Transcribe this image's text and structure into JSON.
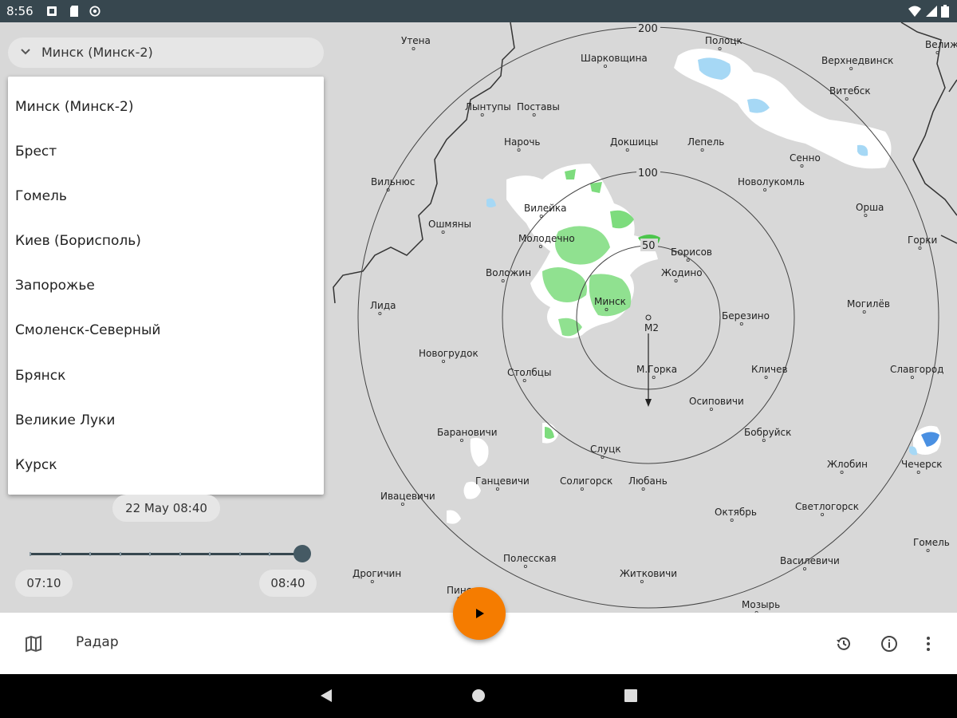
{
  "status_bar": {
    "time": "8:56",
    "icons": [
      "notification-icon",
      "sd-card-icon",
      "sync-icon",
      "wifi-icon",
      "signal-icon",
      "battery-icon"
    ]
  },
  "station_selector": {
    "selected": "Минск (Минск-2)",
    "icon": "chevron-down-icon"
  },
  "station_list": [
    "Минск (Минск-2)",
    "Брест",
    "Гомель",
    "Киев (Борисполь)",
    "Запорожье",
    "Смоленск-Северный",
    "Брянск",
    "Великие Луки",
    "Курск"
  ],
  "timeline": {
    "current": "22 May 08:40",
    "start": "07:10",
    "end": "08:40",
    "position": 1.0
  },
  "map": {
    "ring_labels": [
      "200",
      "100",
      "50"
    ],
    "station_marker": "M2",
    "cities": [
      "Утена",
      "Полоцк",
      "Велиж",
      "Шарковщина",
      "Верхнедвинск",
      "Лынтупы",
      "Поставы",
      "Витебск",
      "Нарочь",
      "Докшицы",
      "Лепель",
      "Сенно",
      "Вильнюс",
      "Новолукомль",
      "Вилейка",
      "Орша",
      "Ошмяны",
      "Молодечно",
      "Борисов",
      "Горки",
      "Воложин",
      "Жодино",
      "Лида",
      "Минск",
      "Березино",
      "Могилёв",
      "Новогрудок",
      "Столбцы",
      "М.Горка",
      "Кличев",
      "Славгород",
      "Осиповичи",
      "Барановичи",
      "Бобруйск",
      "Слуцк",
      "Чечерск",
      "Жлобин",
      "Ганцевичи",
      "Солигорск",
      "Любань",
      "Ивацевичи",
      "Октябрь",
      "Светлогорск",
      "Гомель",
      "Полесская",
      "Василевичи",
      "Дрогичин",
      "Житковичи",
      "Пинск",
      "Мозырь"
    ],
    "colors": {
      "background": "#d8d8d8",
      "rain_light": "#7ddc7d",
      "rain_faint": "#ffffff",
      "snow": "#a6d8f5",
      "snow_heavy": "#4a90e2",
      "borders": "#333333"
    }
  },
  "bottom_bar": {
    "map_icon": "map-icon",
    "title": "Радар",
    "actions": [
      "history-icon",
      "info-icon",
      "more-vert-icon"
    ],
    "play_icon": "play-icon",
    "accent": "#f57c00"
  },
  "nav_bar": {
    "icons": [
      "back-icon",
      "home-icon",
      "recents-icon"
    ]
  }
}
